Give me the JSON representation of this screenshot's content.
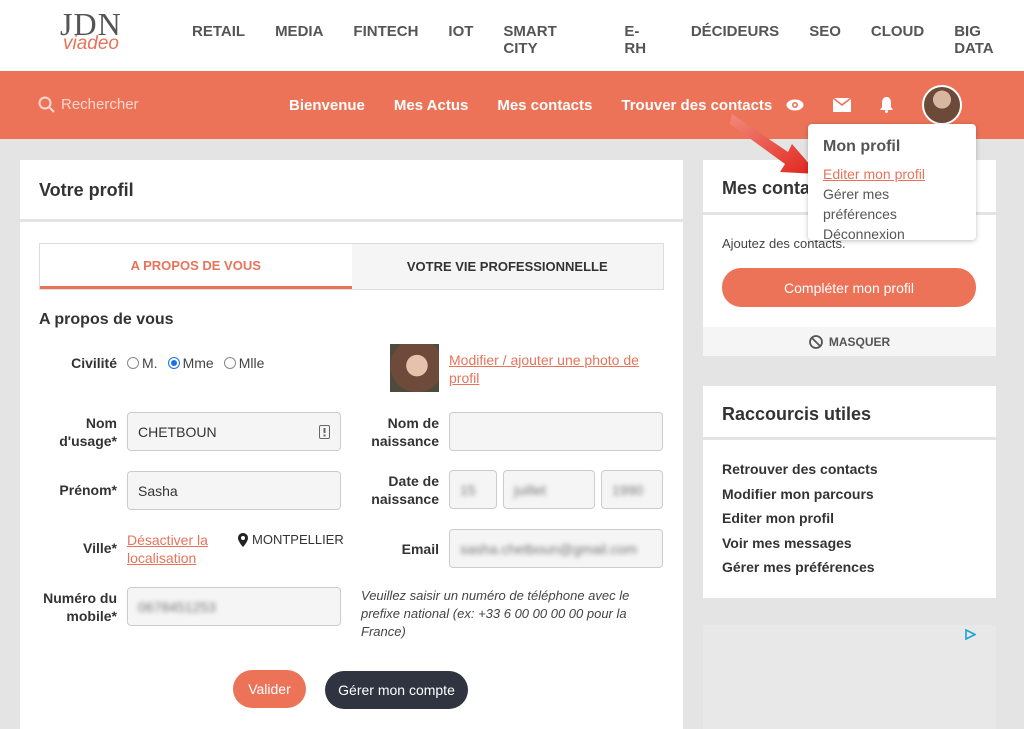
{
  "logo": {
    "jdn": "JDN",
    "viadeo": "viadeo"
  },
  "categories": [
    "RETAIL",
    "MEDIA",
    "FINTECH",
    "IOT",
    "SMART CITY",
    "E-RH",
    "DÉCIDEURS",
    "SEO",
    "CLOUD",
    "BIG DATA"
  ],
  "search": {
    "placeholder": "Rechercher"
  },
  "mainnav": [
    "Bienvenue",
    "Mes Actus",
    "Mes contacts",
    "Trouver des contacts"
  ],
  "dropdown": {
    "title": "Mon profil",
    "items": [
      "Editer mon profil",
      "Gérer mes préférences",
      "Déconnexion"
    ]
  },
  "profile": {
    "title": "Votre profil",
    "tabs": [
      "A PROPOS DE VOUS",
      "VOTRE VIE PROFESSIONNELLE"
    ],
    "section": "A propos de vous",
    "civilite": {
      "label": "Civilité",
      "options": [
        "M.",
        "Mme",
        "Mlle"
      ],
      "selected": "Mme"
    },
    "photo_link": "Modifier / ajouter une photo de profil",
    "nom_usage": {
      "label": "Nom d'usage*",
      "value": "CHETBOUN"
    },
    "nom_naissance": {
      "label": "Nom de naissance",
      "value": ""
    },
    "prenom": {
      "label": "Prénom*",
      "value": "Sasha"
    },
    "date_naissance": {
      "label": "Date de naissance",
      "day": "15",
      "month": "juillet",
      "year": "1990"
    },
    "ville": {
      "label": "Ville*",
      "link": "Désactiver la localisation",
      "value": "MONTPELLIER"
    },
    "email": {
      "label": "Email",
      "value": "sasha.chetboun@gmail.com"
    },
    "mobile": {
      "label": "Numéro du mobile*",
      "value": "0678451253",
      "hint": "Veuillez saisir un numéro de téléphone avec le prefixe national (ex: +33 6 00 00 00 00 pour la France)"
    },
    "buttons": {
      "validate": "Valider",
      "manage": "Gérer mon compte"
    }
  },
  "contacts": {
    "title": "Mes contacts",
    "text": "Ajoutez des contacts.",
    "button": "Compléter mon profil",
    "hide": "MASQUER"
  },
  "shortcuts": {
    "title": "Raccourcis utiles",
    "items": [
      "Retrouver des contacts",
      "Modifier mon parcours",
      "Editer mon profil",
      "Voir mes messages",
      "Gérer mes préférences"
    ]
  },
  "colors": {
    "accent": "#ec7358",
    "dark_button": "#2f3440"
  }
}
